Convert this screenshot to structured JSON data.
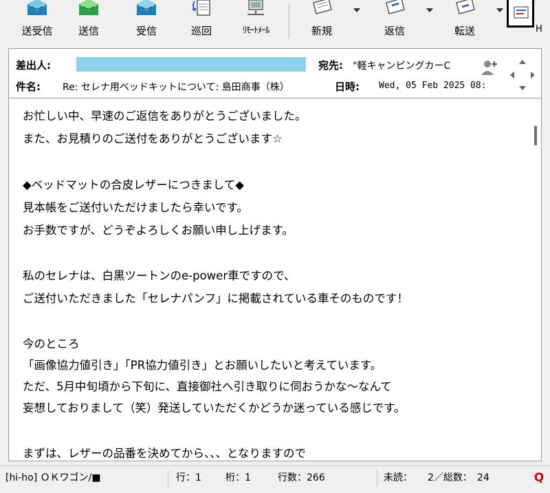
{
  "toolbar": {
    "buttons": [
      {
        "label": "送受信",
        "icon": "send-receive-icon"
      },
      {
        "label": "送信",
        "icon": "send-icon"
      },
      {
        "label": "受信",
        "icon": "receive-icon"
      },
      {
        "label": "巡回",
        "icon": "patrol-icon"
      },
      {
        "label": "ﾘﾓｰﾄﾒｰﾙ",
        "icon": "remote-mail-icon"
      },
      {
        "label": "新規",
        "icon": "new-mail-icon"
      },
      {
        "label": "返信",
        "icon": "reply-icon"
      },
      {
        "label": "転送",
        "icon": "forward-icon"
      }
    ],
    "overflow_label": "H"
  },
  "header": {
    "from_label": "差出人:",
    "to_label": "宛先:",
    "to_value": "\"軽キャンピングカーC",
    "subject_label": "件名:",
    "subject_value": "Re: セレナ用ベッドキットについて: 島田商事（株）",
    "date_label": "日時:",
    "date_value": "Wed, 05 Feb 2025 08:"
  },
  "body": {
    "lines": [
      "お忙しい中、早速のご返信をありがとうございました。",
      "また、お見積りのご送付をありがとうございます☆",
      "",
      "◆ベッドマットの合皮レザーにつきまして◆",
      "見本帳をご送付いただけましたら幸いです。",
      "お手数ですが、どうぞよろしくお願い申し上げます。",
      "",
      "私のセレナは、白黒ツートンのe-power車ですので、",
      "ご送付いただきました「セレナパンフ」に掲載されている車そのものです！",
      "",
      "今のところ",
      "「画像協力値引き」「PR協力値引き」とお願いしたいと考えています。",
      "ただ、5月中旬頃から下旬に、直接御社へ引き取りに伺おうかな～なんて",
      "妄想しておりまして（笑）発送していただくかどうか迷っている感じです。",
      "",
      "まずは、レザーの品番を決めてから、、、となりますので"
    ]
  },
  "status": {
    "account": "[hi-ho] ＯＫワゴン/■",
    "row": "行：1",
    "col": "桁：1",
    "lines": "行数：266",
    "unread": "未読：",
    "count": "2／総数：　24",
    "q_label": "Q"
  },
  "colors": {
    "sender_highlight": "#8ed3ea",
    "q_icon": "#d4000a"
  }
}
